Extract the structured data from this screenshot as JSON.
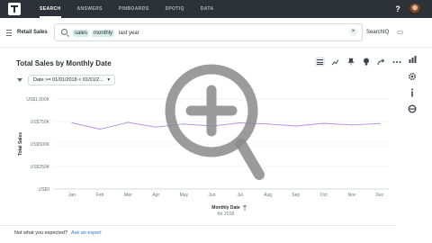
{
  "nav": {
    "items": [
      "SEARCH",
      "ANSWERS",
      "PINBOARDS",
      "SPOTIQ",
      "DATA"
    ],
    "active_index": 0,
    "help_label": "?"
  },
  "source": {
    "label": "Retail Sales"
  },
  "search": {
    "tokens": [
      {
        "text": "sales",
        "kind": "column"
      },
      {
        "text": "monthly",
        "kind": "column"
      },
      {
        "text": "last year",
        "kind": "plain"
      }
    ],
    "clear_label": "×",
    "searchiq_label": "SearchIQ"
  },
  "answer": {
    "title": "Total Sales by Monthly Date",
    "filter_label": "Date >= 01/01/2018 < 01/01/2..."
  },
  "toolbar": {
    "icons": [
      "table-view-icon",
      "chart-view-icon",
      "pin-icon",
      "insight-bulb-icon",
      "share-icon",
      "more-icon"
    ]
  },
  "rail": {
    "icons": [
      "chart-type-icon",
      "settings-gear-icon",
      "info-icon",
      "spotiq-icon"
    ]
  },
  "chart_data": {
    "type": "line",
    "title": "",
    "xlabel": "Monthly Date",
    "xlabel_sub": "for 2018",
    "ylabel": "Total Sales",
    "categories": [
      "Jan",
      "Feb",
      "Mar",
      "Apr",
      "May",
      "Jun",
      "Jul",
      "Aug",
      "Sep",
      "Oct",
      "Nov",
      "Dec"
    ],
    "series": [
      {
        "values": [
          735000,
          665000,
          740000,
          688000,
          722000,
          700000,
          735000,
          722000,
          700000,
          730000,
          712000,
          728000
        ],
        "color": "#b48fe0"
      }
    ],
    "y_ticks": [
      "US$0",
      "US$250K",
      "US$500K",
      "US$750K",
      "US$1,000K"
    ],
    "ylim": [
      0,
      1000000
    ],
    "grid": true
  },
  "footer": {
    "question": "Not what you expected?",
    "link": "Ask an expert"
  },
  "colors": {
    "topbar": "#2c3238",
    "accent_link": "#2e75d6",
    "token_bg": "#d8eee8",
    "series": "#b48fe0"
  }
}
